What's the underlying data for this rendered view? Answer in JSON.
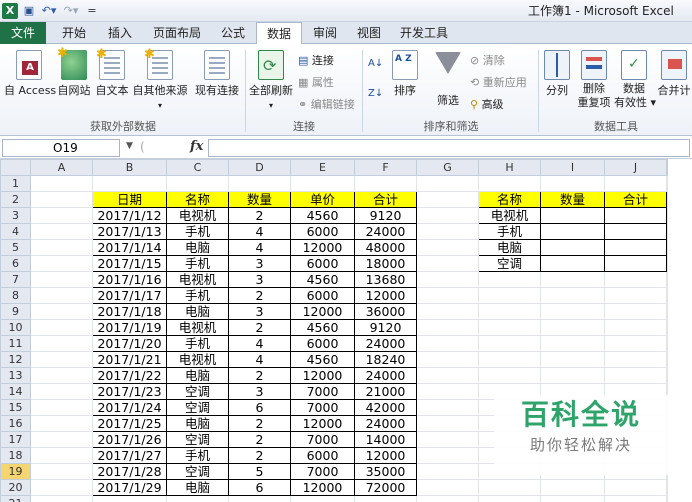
{
  "app": {
    "title": "工作簿1 - Microsoft Excel",
    "icon_label": "X",
    "qat": {
      "save_icon": "save-icon",
      "undo_icon": "undo-icon",
      "redo_icon": "redo-icon",
      "more": "="
    }
  },
  "tabs": [
    {
      "label": "文件"
    },
    {
      "label": "开始"
    },
    {
      "label": "插入"
    },
    {
      "label": "页面布局"
    },
    {
      "label": "公式"
    },
    {
      "label": "数据"
    },
    {
      "label": "审阅"
    },
    {
      "label": "视图"
    },
    {
      "label": "开发工具"
    }
  ],
  "ribbon": {
    "external": {
      "access": "自 Access",
      "web": "自网站",
      "text": "自文本",
      "other": "自其他来源",
      "existing": "现有连接",
      "group": "获取外部数据"
    },
    "connections": {
      "refresh_all": "全部刷新",
      "connections": "连接",
      "properties": "属性",
      "edit_links": "编辑链接",
      "group": "连接"
    },
    "sortfilter": {
      "sort_az": "A Z",
      "sort_za": "Z A",
      "sort": "排序",
      "filter": "筛选",
      "clear": "清除",
      "reapply": "重新应用",
      "advanced": "高级",
      "group": "排序和筛选"
    },
    "datatools": {
      "split": "分列",
      "remove_dup": "删除\n重复项",
      "remove_dup_1": "删除",
      "remove_dup_2": "重复项",
      "validation_1": "数据",
      "validation_2": "有效性 ▾",
      "consolidate": "合并计",
      "group": "数据工具"
    }
  },
  "formula_bar": {
    "name_box": "O19",
    "fx": "fx",
    "cancel": "✕",
    "value": ""
  },
  "sheet": {
    "columns": [
      "A",
      "B",
      "C",
      "D",
      "E",
      "F",
      "G",
      "H",
      "I",
      "J"
    ],
    "rows": [
      "1",
      "2",
      "3",
      "4",
      "5",
      "6",
      "7",
      "8",
      "9",
      "10",
      "11",
      "12",
      "13",
      "14",
      "15",
      "16",
      "17",
      "18",
      "19",
      "20",
      "21"
    ],
    "highlight_row": "19",
    "main_table": {
      "headers": [
        "日期",
        "名称",
        "数量",
        "单价",
        "合计"
      ],
      "rows": [
        [
          "2017/1/12",
          "电视机",
          "2",
          "4560",
          "9120"
        ],
        [
          "2017/1/13",
          "手机",
          "4",
          "6000",
          "24000"
        ],
        [
          "2017/1/14",
          "电脑",
          "4",
          "12000",
          "48000"
        ],
        [
          "2017/1/15",
          "手机",
          "3",
          "6000",
          "18000"
        ],
        [
          "2017/1/16",
          "电视机",
          "3",
          "4560",
          "13680"
        ],
        [
          "2017/1/17",
          "手机",
          "2",
          "6000",
          "12000"
        ],
        [
          "2017/1/18",
          "电脑",
          "3",
          "12000",
          "36000"
        ],
        [
          "2017/1/19",
          "电视机",
          "2",
          "4560",
          "9120"
        ],
        [
          "2017/1/20",
          "手机",
          "4",
          "6000",
          "24000"
        ],
        [
          "2017/1/21",
          "电视机",
          "4",
          "4560",
          "18240"
        ],
        [
          "2017/1/22",
          "电脑",
          "2",
          "12000",
          "24000"
        ],
        [
          "2017/1/23",
          "空调",
          "3",
          "7000",
          "21000"
        ],
        [
          "2017/1/24",
          "空调",
          "6",
          "7000",
          "42000"
        ],
        [
          "2017/1/25",
          "电脑",
          "2",
          "12000",
          "24000"
        ],
        [
          "2017/1/26",
          "空调",
          "2",
          "7000",
          "14000"
        ],
        [
          "2017/1/27",
          "手机",
          "2",
          "6000",
          "12000"
        ],
        [
          "2017/1/28",
          "空调",
          "5",
          "7000",
          "35000"
        ],
        [
          "2017/1/29",
          "电脑",
          "6",
          "12000",
          "72000"
        ]
      ]
    },
    "summary_table": {
      "headers": [
        "名称",
        "数量",
        "合计"
      ],
      "items": [
        "电视机",
        "手机",
        "电脑",
        "空调"
      ]
    }
  },
  "watermark": {
    "main": "百科全说",
    "sub": "助你轻松解决"
  },
  "colors": {
    "header_fill": "#ffff00",
    "file_tab": "#1f7246",
    "watermark_green": "#2ea46a"
  }
}
